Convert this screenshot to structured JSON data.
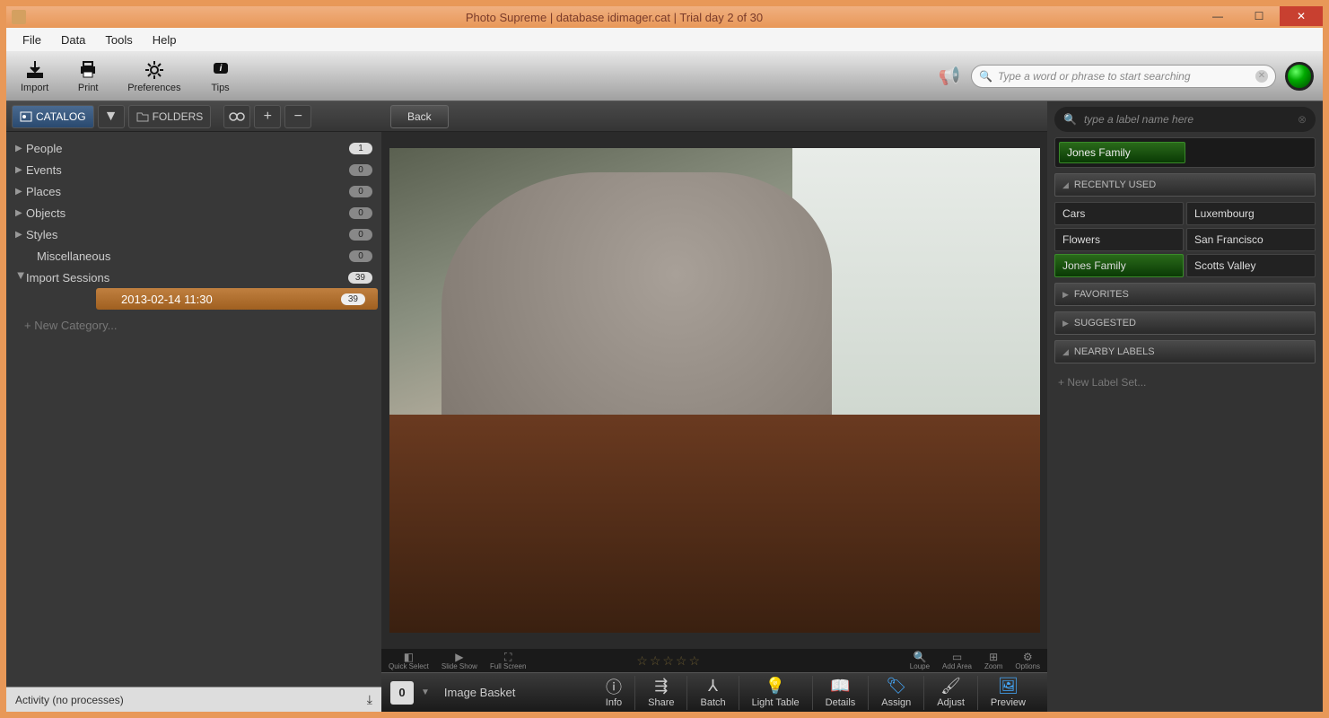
{
  "titlebar": {
    "title": "Photo Supreme | database idimager.cat | Trial day 2 of 30"
  },
  "menu": {
    "file": "File",
    "data": "Data",
    "tools": "Tools",
    "help": "Help"
  },
  "toolbar": {
    "import": "Import",
    "print": "Print",
    "preferences": "Preferences",
    "tips": "Tips"
  },
  "search": {
    "placeholder": "Type a word or phrase to start searching"
  },
  "sidebar": {
    "tab_catalog": "CATALOG",
    "tab_folders": "FOLDERS",
    "items": [
      {
        "label": "People",
        "count": "1"
      },
      {
        "label": "Events",
        "count": "0"
      },
      {
        "label": "Places",
        "count": "0"
      },
      {
        "label": "Objects",
        "count": "0"
      },
      {
        "label": "Styles",
        "count": "0"
      },
      {
        "label": "Miscellaneous",
        "count": "0"
      },
      {
        "label": "Import Sessions",
        "count": "39"
      }
    ],
    "selected": {
      "label": "2013-02-14 11:30",
      "count": "39"
    },
    "new_category": "+   New Category..."
  },
  "center": {
    "back": "Back"
  },
  "mini": {
    "quick": "Quick Select",
    "slide": "Slide Show",
    "full": "Full Screen",
    "loupe": "Loupe",
    "addarea": "Add Area",
    "zoom": "Zoom",
    "options": "Options"
  },
  "bottom": {
    "basket_count": "0",
    "basket_label": "Image Basket",
    "info": "Info",
    "share": "Share",
    "batch": "Batch",
    "light": "Light Table",
    "details": "Details",
    "assign": "Assign",
    "adjust": "Adjust",
    "preview": "Preview"
  },
  "activity": {
    "text": "Activity (no processes)"
  },
  "right": {
    "search_placeholder": "type a label name here",
    "current_label": "Jones Family",
    "recently_used": "RECENTLY USED",
    "labels": [
      {
        "name": "Cars",
        "active": false
      },
      {
        "name": "Luxembourg",
        "active": false
      },
      {
        "name": "Flowers",
        "active": false
      },
      {
        "name": "San Francisco",
        "active": false
      },
      {
        "name": "Jones Family",
        "active": true
      },
      {
        "name": "Scotts Valley",
        "active": false
      }
    ],
    "favorites": "FAVORITES",
    "suggested": "SUGGESTED",
    "nearby": "NEARBY LABELS",
    "new_label": "+   New Label Set..."
  }
}
